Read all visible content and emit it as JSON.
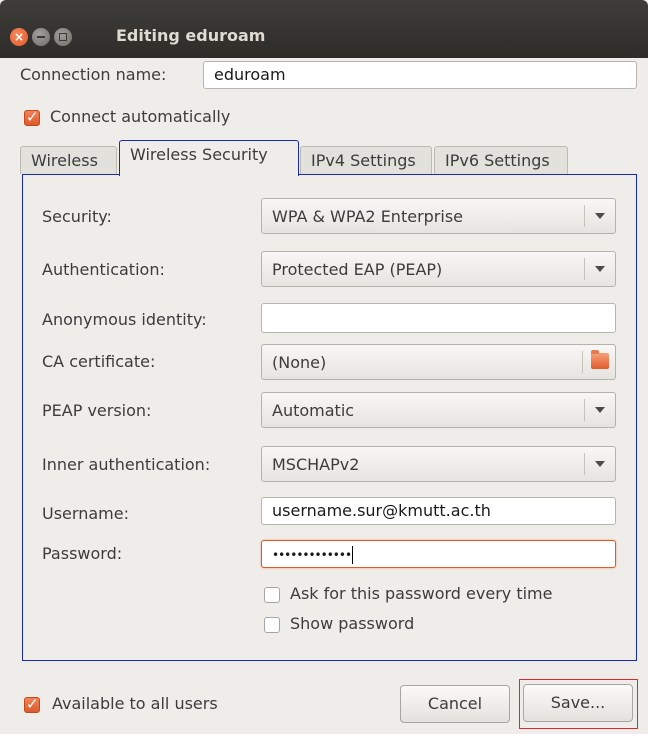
{
  "window": {
    "title": "Editing eduroam",
    "close_glyph": "×"
  },
  "connection": {
    "name_label": "Connection name:",
    "name_value": "eduroam",
    "auto_connect_label": "Connect automatically",
    "auto_connect_checked": true
  },
  "tabs": [
    {
      "label": "Wireless"
    },
    {
      "label": "Wireless Security"
    },
    {
      "label": "IPv4 Settings"
    },
    {
      "label": "IPv6 Settings"
    }
  ],
  "security": {
    "security_label": "Security:",
    "security_value": "WPA & WPA2 Enterprise",
    "auth_label": "Authentication:",
    "auth_value": "Protected EAP (PEAP)",
    "anon_label": "Anonymous identity:",
    "anon_value": "",
    "ca_label": "CA certificate:",
    "ca_value": "(None)",
    "peap_label": "PEAP version:",
    "peap_value": "Automatic",
    "inner_label": "Inner authentication:",
    "inner_value": "MSCHAPv2",
    "username_label": "Username:",
    "username_value": "username.sur@kmutt.ac.th",
    "password_label": "Password:",
    "password_mask": "•••••••••••••",
    "ask_password_label": "Ask for this password every time",
    "show_password_label": "Show password"
  },
  "footer": {
    "all_users_label": "Available to all users",
    "cancel_label": "Cancel",
    "save_label": "Save..."
  },
  "icons": {
    "close": "close-icon",
    "minimize": "minimize-icon",
    "maximize": "maximize-icon",
    "dropdown": "chevron-down-icon",
    "folder": "folder-icon",
    "checkbox_checked": "check-icon"
  },
  "colors": {
    "accent": "#dd5a2b",
    "focus_outline": "#1a2ab4",
    "save_highlight": "#d9292e"
  }
}
